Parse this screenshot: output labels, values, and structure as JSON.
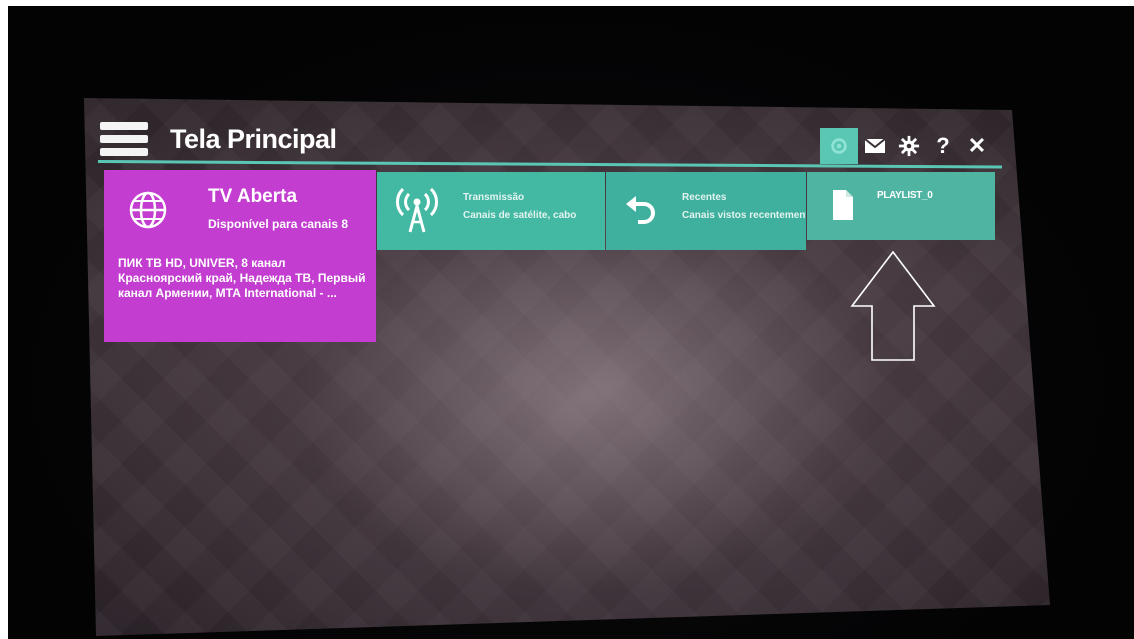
{
  "header": {
    "title": "Tela Principal"
  },
  "toolbar": {
    "buttons": [
      {
        "icon": "gear-icon",
        "active": true
      },
      {
        "icon": "mail-icon",
        "active": false
      },
      {
        "icon": "settings-icon",
        "active": false
      },
      {
        "label": "?",
        "icon": "help-icon"
      },
      {
        "label": "✕",
        "icon": "close-icon"
      }
    ]
  },
  "tiles": {
    "tv_aberta": {
      "title": "TV Aberta",
      "subtitle": "Disponível para canais 8",
      "channels": "ПИК ТВ HD, UNIVER, 8 канал Красноярский край, Надежда ТВ, Первый канал Армении, МТА International - ...",
      "color": "#c33ed0"
    },
    "transmissao": {
      "title": "Transmissão",
      "subtitle": "Canais de satélite, cabo",
      "color": "#43b8a3"
    },
    "recentes": {
      "title": "Recentes",
      "subtitle": "Canais vistos recentemente",
      "color": "#3fb09d"
    },
    "playlist": {
      "title": "PLAYLIST_0",
      "color": "#4fb5a2"
    }
  },
  "colors": {
    "accent": "#5ac6b4"
  }
}
